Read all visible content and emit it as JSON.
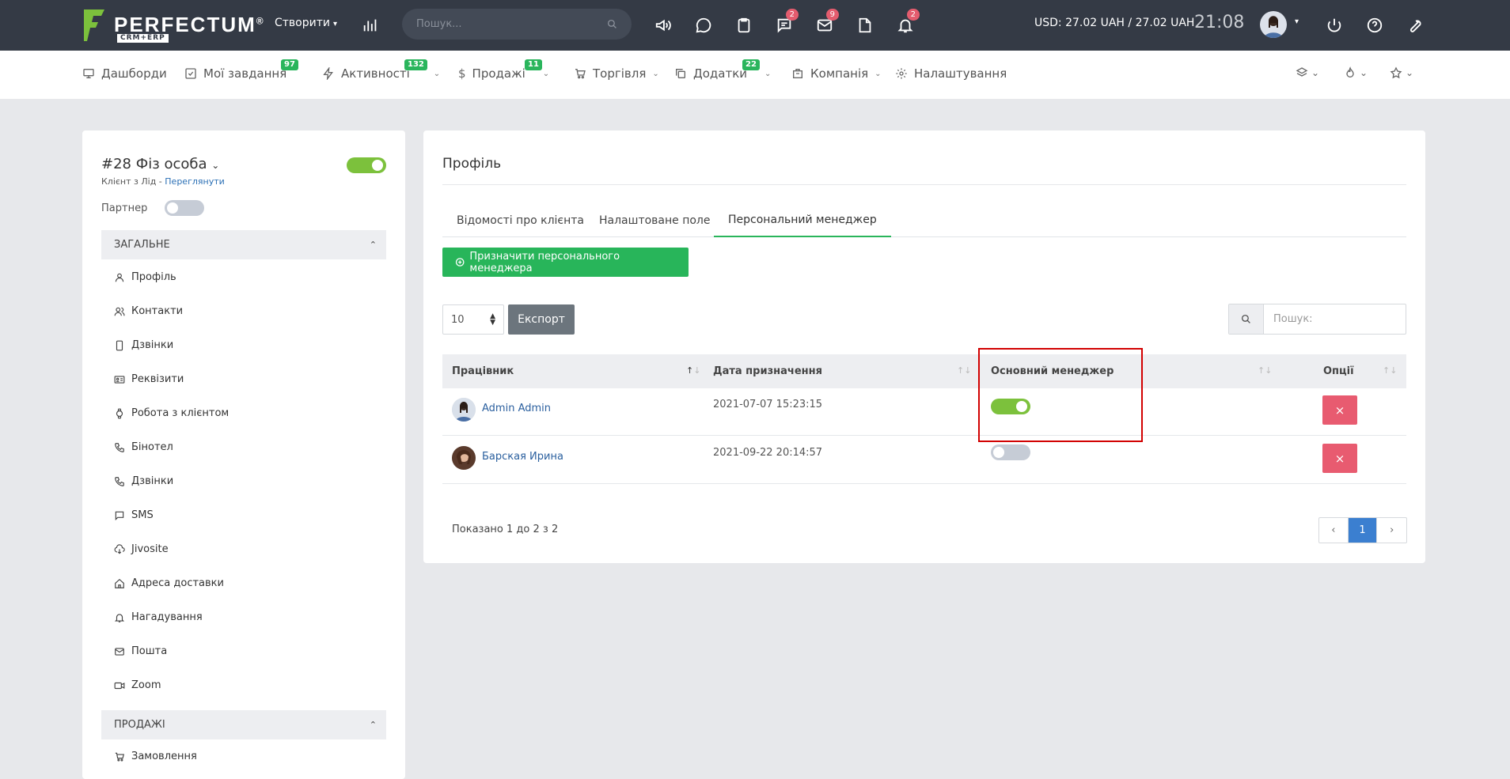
{
  "topbar": {
    "logo_text": "PERFECTUM",
    "logo_reg": "®",
    "logo_sub": "CRM+ERP",
    "create_label": "Створити",
    "search_placeholder": "Пошук...",
    "badges": {
      "chat": "2",
      "mail": "9",
      "bell": "2"
    },
    "currency": "USD: 27.02 UAH / 27.02 UAH",
    "clock": "21:08"
  },
  "nav": {
    "items": [
      {
        "label": "Дашборди"
      },
      {
        "label": "Мої завдання",
        "badge": "97"
      },
      {
        "label": "Активності",
        "badge": "132"
      },
      {
        "label": "Продажі",
        "badge": "11"
      },
      {
        "label": "Торгівля"
      },
      {
        "label": "Додатки",
        "badge": "22"
      },
      {
        "label": "Компанія"
      },
      {
        "label": "Налаштування"
      }
    ]
  },
  "client": {
    "title": "#28 Фіз особа",
    "subtitle_prefix": "Клієнт з Лід - ",
    "subtitle_link": "Переглянути",
    "partner_label": "Партнер",
    "active": true,
    "partner": false
  },
  "sidebar": {
    "section_general": "ЗАГАЛЬНЕ",
    "items": [
      {
        "label": "Профіль"
      },
      {
        "label": "Контакти"
      },
      {
        "label": "Дзвінки"
      },
      {
        "label": "Реквізити"
      },
      {
        "label": "Робота з клієнтом"
      },
      {
        "label": "Бінотел"
      },
      {
        "label": "Дзвінки"
      },
      {
        "label": "SMS"
      },
      {
        "label": "Jivosite"
      },
      {
        "label": "Адреса доставки"
      },
      {
        "label": "Нагадування"
      },
      {
        "label": "Пошта"
      },
      {
        "label": "Zoom"
      }
    ],
    "section_sales": "ПРОДАЖІ",
    "sales_first": "Замовлення"
  },
  "main": {
    "title": "Профіль",
    "tabs": [
      {
        "label": "Відомості про клієнта"
      },
      {
        "label": "Налаштоване поле"
      },
      {
        "label": "Персональний менеджер"
      }
    ],
    "assign_button": "Призначити персонального менеджера",
    "page_size": "10",
    "export_label": "Експорт",
    "search_placeholder": "Пошук:",
    "columns": [
      "Працівник",
      "Дата призначення",
      "Основний менеджер",
      "Опції"
    ],
    "rows": [
      {
        "employee": "Admin Admin",
        "date": "2021-07-07 15:23:15",
        "main_manager": true
      },
      {
        "employee": "Барская Ирина",
        "date": "2021-09-22 20:14:57",
        "main_manager": false
      }
    ],
    "delete_symbol": "×",
    "shown_text": "Показано 1 до 2 з 2",
    "pager": {
      "prev": "‹",
      "current": "1",
      "next": "›"
    }
  },
  "colors": {
    "accent": "#28b55a",
    "toggle_on": "#7cc13c",
    "danger": "#e85b70",
    "topbar": "#343a45",
    "highlight": "#d20000"
  }
}
